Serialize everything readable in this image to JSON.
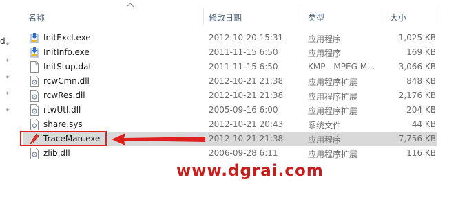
{
  "nav": {
    "partial_letter": "d"
  },
  "columns": {
    "name": "名称",
    "date": "修改日期",
    "type": "类型",
    "size": "大小"
  },
  "files": [
    {
      "name": "InitExcl.exe",
      "date": "2012-10-20 15:31",
      "type": "应用程序",
      "size": "1,025 KB",
      "icon": "installer-exe-icon"
    },
    {
      "name": "InitInfo.exe",
      "date": "2011-11-15 6:50",
      "type": "应用程序",
      "size": "169 KB",
      "icon": "installer-exe-icon"
    },
    {
      "name": "InitStup.dat",
      "date": "2011-11-15 6:50",
      "type": "KMP - MPEG M...",
      "size": "3,066 KB",
      "icon": "blank-file-icon"
    },
    {
      "name": "rcwCmn.dll",
      "date": "2012-10-21 21:38",
      "type": "应用程序扩展",
      "size": "848 KB",
      "icon": "dll-file-icon"
    },
    {
      "name": "rcwRes.dll",
      "date": "2012-10-21 21:38",
      "type": "应用程序扩展",
      "size": "2,176 KB",
      "icon": "dll-file-icon"
    },
    {
      "name": "rtwUtl.dll",
      "date": "2005-09-16 6:00",
      "type": "应用程序扩展",
      "size": "204 KB",
      "icon": "dll-file-icon"
    },
    {
      "name": "share.sys",
      "date": "2012-10-21 20:43",
      "type": "系统文件",
      "size": "44 KB",
      "icon": "sys-file-icon"
    },
    {
      "name": "TraceMan.exe",
      "date": "2012-10-21 21:38",
      "type": "应用程序",
      "size": "7,756 KB",
      "icon": "pen-app-icon",
      "selected": true
    },
    {
      "name": "zlib.dll",
      "date": "2006-09-28 6:11",
      "type": "应用程序扩展",
      "size": "116 KB",
      "icon": "dll-file-icon"
    }
  ],
  "annotation": {
    "watermark": "www.dgrai.com",
    "color": "#e0201d"
  }
}
